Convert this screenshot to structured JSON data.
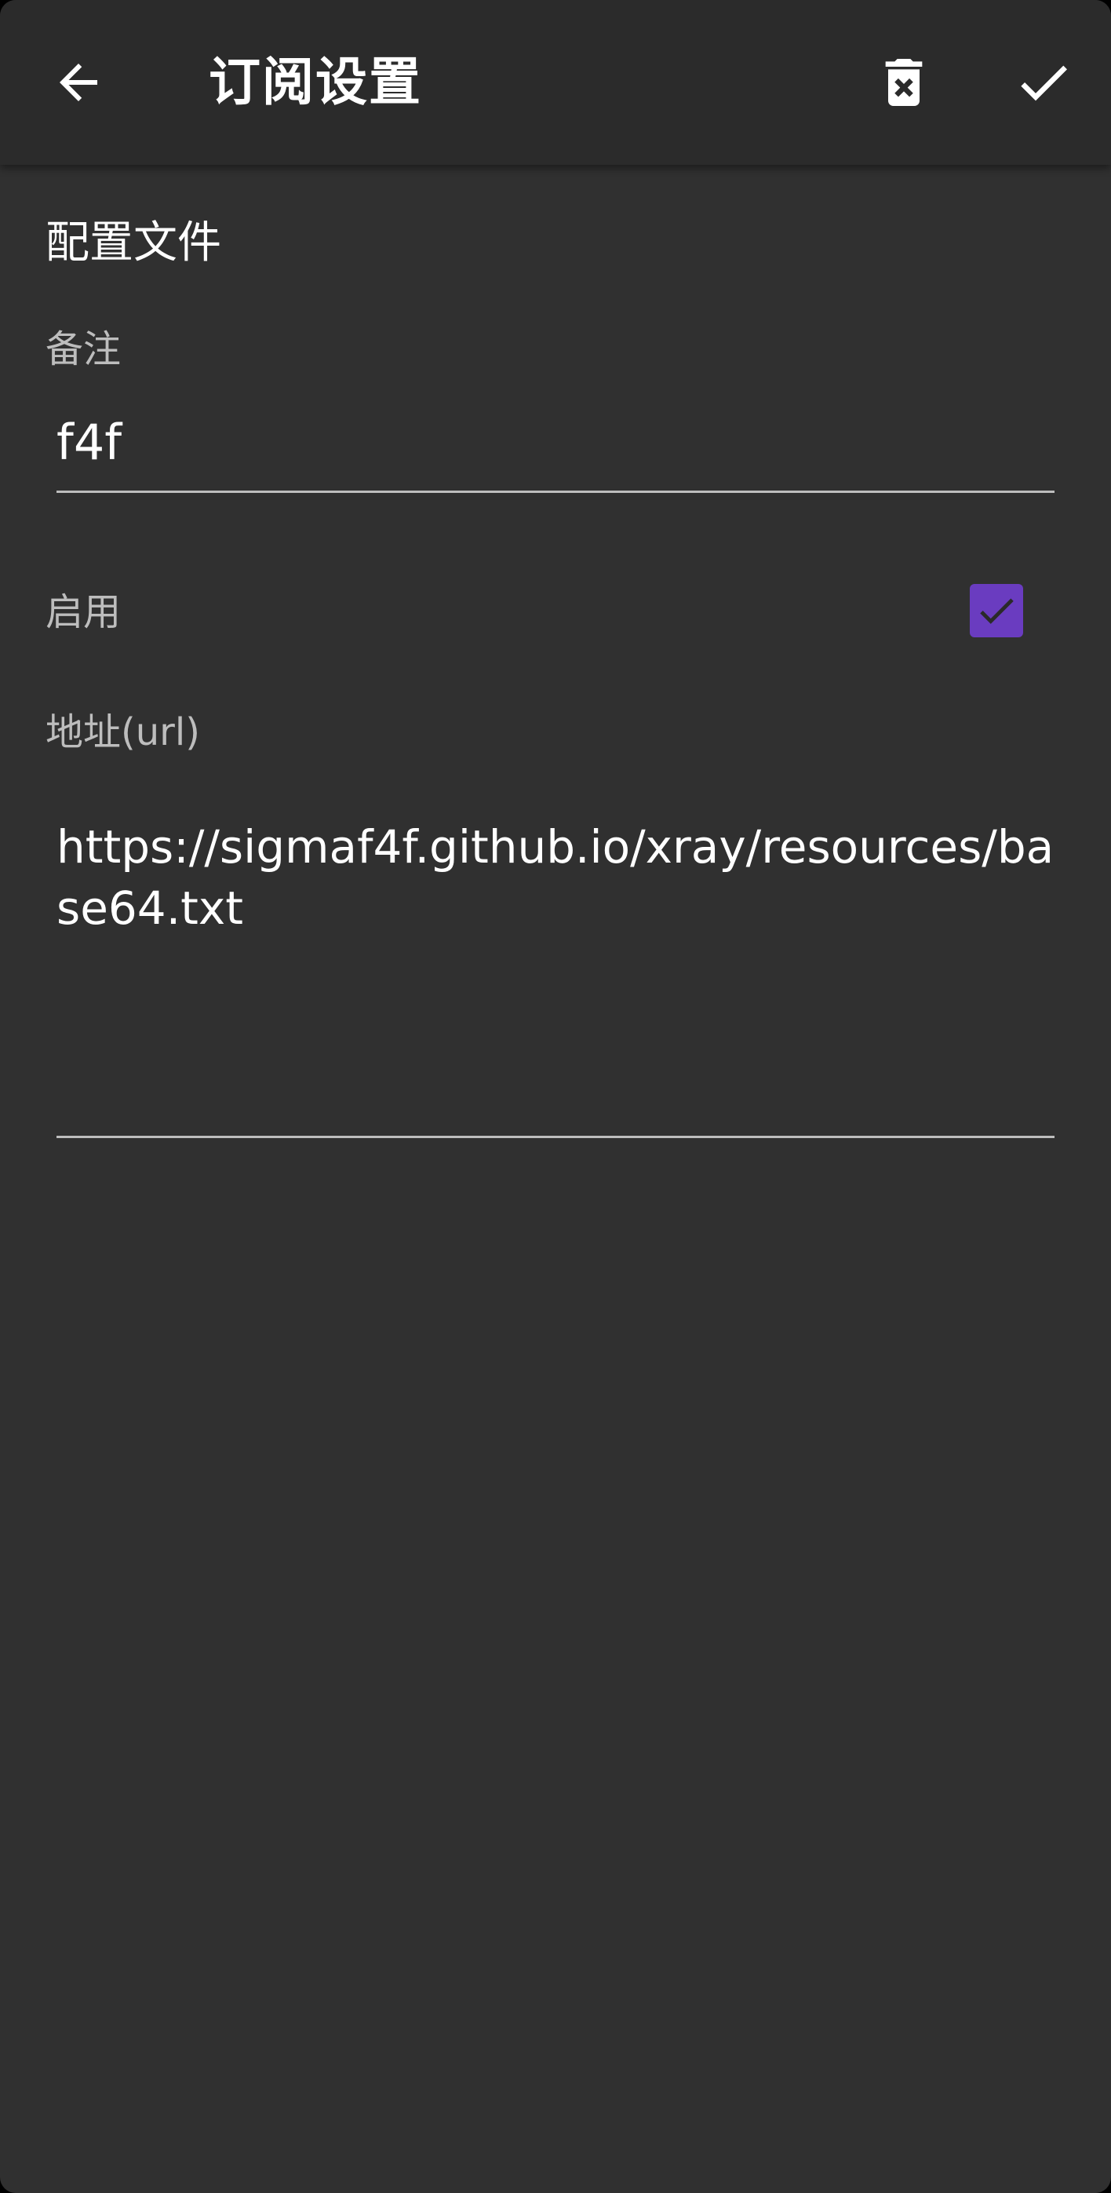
{
  "toolbar": {
    "title": "订阅设置",
    "back_icon": "arrow-back-icon",
    "delete_icon": "delete-forever-icon",
    "confirm_icon": "check-icon"
  },
  "form": {
    "section_title": "配置文件",
    "remarks": {
      "label": "备注",
      "value": "f4f"
    },
    "enable": {
      "label": "启用",
      "checked": true
    },
    "url": {
      "label": "地址(url)",
      "value": "https://sigmaf4f.github.io/xray/resources/base64.txt"
    }
  },
  "colors": {
    "background": "#303030",
    "toolbar": "#2b2b2b",
    "accent": "#6a3cc0",
    "text_primary": "#ffffff",
    "text_secondary": "#bdbdbd"
  }
}
